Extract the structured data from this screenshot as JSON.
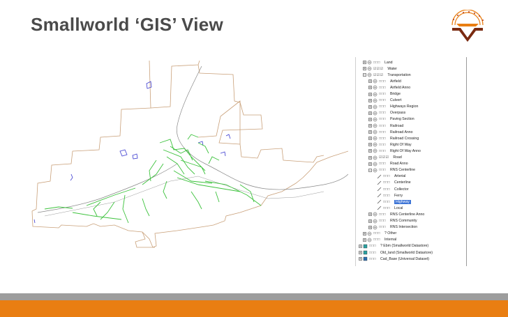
{
  "slide": {
    "title": "Smallworld ‘GIS’ View"
  },
  "colors": {
    "accent_orange": "#e97e12",
    "band_grey": "#9d9d9d",
    "title_text": "#4a4a4a",
    "boundary": "#c9a079",
    "road": "#3cc23c",
    "water": "#3b3bd0",
    "selection": "#3d74d6"
  },
  "layer_tree": {
    "rows": [
      {
        "label": "Land",
        "expander": "+",
        "vis": "□□□",
        "icon": "dataset-icon"
      },
      {
        "label": "Water",
        "expander": "+",
        "vis": "☑☑☑",
        "icon": "dataset-icon"
      },
      {
        "label": "Transportation",
        "expander": "−",
        "vis": "☑☑☑",
        "icon": "dataset-icon"
      },
      {
        "label": "Airfield",
        "expander": "+",
        "vis": "□□□",
        "icon": "layer-icon"
      },
      {
        "label": "Airfield Anno",
        "expander": "+",
        "vis": "□□□",
        "icon": "layer-icon"
      },
      {
        "label": "Bridge",
        "expander": "+",
        "vis": "□□□",
        "icon": "layer-icon"
      },
      {
        "label": "Culvert",
        "expander": "+",
        "vis": "□□□",
        "icon": "layer-icon"
      },
      {
        "label": "Highways Region",
        "expander": "+",
        "vis": "□□□",
        "icon": "layer-icon"
      },
      {
        "label": "Overpass",
        "expander": "+",
        "vis": "□□□",
        "icon": "layer-icon"
      },
      {
        "label": "Paving Section",
        "expander": "+",
        "vis": "□□□",
        "icon": "layer-icon"
      },
      {
        "label": "Railroad",
        "expander": "+",
        "vis": "□□□",
        "icon": "layer-icon"
      },
      {
        "label": "Railroad Anno",
        "expander": "+",
        "vis": "□□□",
        "icon": "layer-icon"
      },
      {
        "label": "Railroad Crossing",
        "expander": "+",
        "vis": "□□□",
        "icon": "layer-icon"
      },
      {
        "label": "Right Of Way",
        "expander": "+",
        "vis": "□□□",
        "icon": "layer-icon"
      },
      {
        "label": "Right Of Way Anno",
        "expander": "+",
        "vis": "□□□",
        "icon": "layer-icon"
      },
      {
        "label": "Road",
        "expander": "+",
        "vis": "☑☑☑",
        "icon": "layer-icon"
      },
      {
        "label": "Road Anno",
        "expander": "+",
        "vis": "□□□",
        "icon": "layer-icon"
      },
      {
        "label": "RNS Centerline",
        "expander": "−",
        "vis": "□□□",
        "icon": "layer-icon"
      },
      {
        "label": "Arterial",
        "expander": "",
        "vis": "□□□",
        "icon": "line-style-icon"
      },
      {
        "label": "Centerline",
        "expander": "",
        "vis": "□□□",
        "icon": "line-style-icon"
      },
      {
        "label": "Collector",
        "expander": "",
        "vis": "□□□",
        "icon": "line-style-icon"
      },
      {
        "label": "Ferry",
        "expander": "",
        "vis": "□□□",
        "icon": "line-style-icon"
      },
      {
        "label": "Highway",
        "expander": "",
        "vis": "□□□",
        "icon": "line-style-icon",
        "selected": true
      },
      {
        "label": "Local",
        "expander": "",
        "vis": "□□□",
        "icon": "line-style-icon"
      },
      {
        "label": "RNS Centerline Anno",
        "expander": "+",
        "vis": "□□□",
        "icon": "layer-icon"
      },
      {
        "label": "RNS Community",
        "expander": "+",
        "vis": "□□□",
        "icon": "layer-icon"
      },
      {
        "label": "RNS Intersection",
        "expander": "+",
        "vis": "□□□",
        "icon": "layer-icon"
      },
      {
        "label": "? Other",
        "expander": "+",
        "vis": "□□□",
        "icon": "dataset-icon"
      },
      {
        "label": "Internal",
        "expander": "+",
        "vis": "□□□",
        "icon": "dataset-icon"
      },
      {
        "label": "? Ebm (Smallworld Datastore)",
        "expander": "+",
        "vis": "□□□",
        "icon": "datastore-icon"
      },
      {
        "label": "Old_land (Smallworld Datastore)",
        "expander": "+",
        "vis": "□□□",
        "icon": "datastore-icon"
      },
      {
        "label": "Cad_Base (Universal Dataset)",
        "expander": "+",
        "vis": "□□□",
        "icon": "universal-dataset-icon"
      }
    ]
  }
}
